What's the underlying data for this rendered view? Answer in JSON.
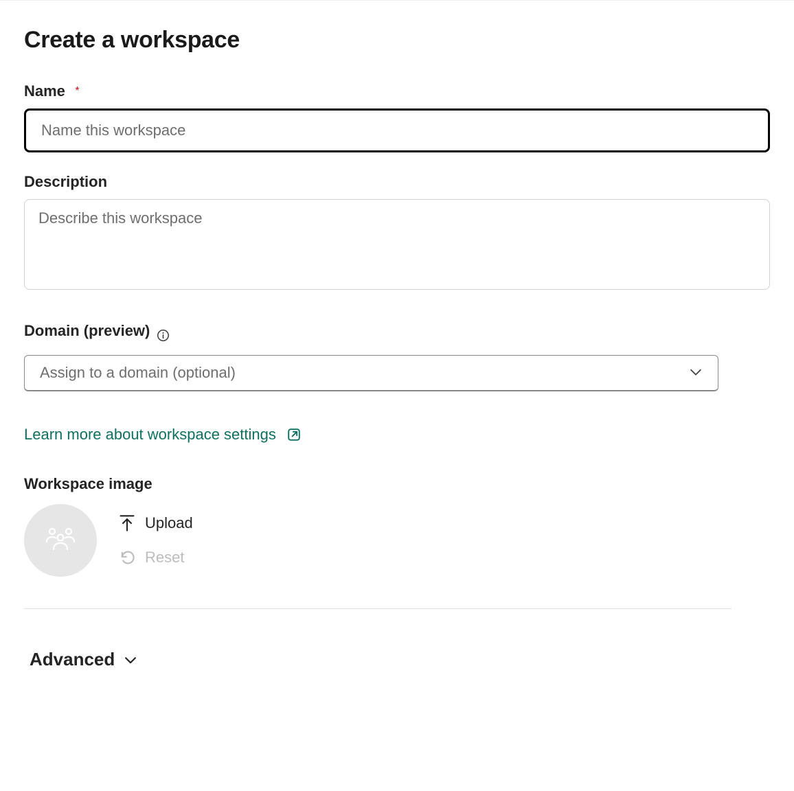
{
  "title": "Create a workspace",
  "fields": {
    "name": {
      "label": "Name",
      "placeholder": "Name this workspace",
      "required_indicator": "*",
      "value": ""
    },
    "description": {
      "label": "Description",
      "placeholder": "Describe this workspace",
      "value": ""
    },
    "domain": {
      "label": "Domain (preview)",
      "placeholder": "Assign to a domain (optional)"
    }
  },
  "learn_more_link": "Learn more about workspace settings",
  "workspace_image": {
    "label": "Workspace image",
    "upload_label": "Upload",
    "reset_label": "Reset"
  },
  "advanced_label": "Advanced"
}
